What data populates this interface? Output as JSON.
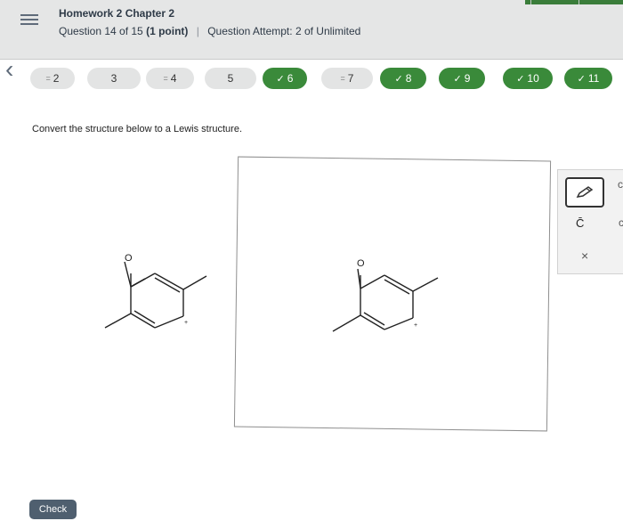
{
  "header": {
    "title": "Homework 2 Chapter 2",
    "question_info": "Question 14 of 15",
    "points": "(1 point)",
    "attempt_label": "Question Attempt:",
    "attempt_value": "2 of Unlimited"
  },
  "question_nav": [
    {
      "mark": "=",
      "label": "2",
      "status": "partial"
    },
    {
      "mark": "",
      "label": "3",
      "status": "unanswered"
    },
    {
      "mark": "=",
      "label": "4",
      "status": "partial"
    },
    {
      "mark": "",
      "label": "5",
      "status": "unanswered"
    },
    {
      "mark": "✓",
      "label": "6",
      "status": "done"
    },
    {
      "mark": "=",
      "label": "7",
      "status": "partial"
    },
    {
      "mark": "✓",
      "label": "8",
      "status": "done"
    },
    {
      "mark": "✓",
      "label": "9",
      "status": "done"
    },
    {
      "mark": "✓",
      "label": "10",
      "status": "done"
    },
    {
      "mark": "✓",
      "label": "11",
      "status": "done"
    }
  ],
  "question": {
    "prompt": "Convert the structure below to a Lewis structure."
  },
  "molecule": {
    "atom_label": "O",
    "charge_label": "+"
  },
  "toolbar": {
    "pencil_icon": "pencil-icon",
    "charge_label": "C̄",
    "delete_label": "×"
  },
  "check_button": "Check",
  "colors": {
    "header_bg": "#e5e6e6",
    "done_green": "#3a8a3a",
    "check_bg": "#4f5f6f"
  }
}
